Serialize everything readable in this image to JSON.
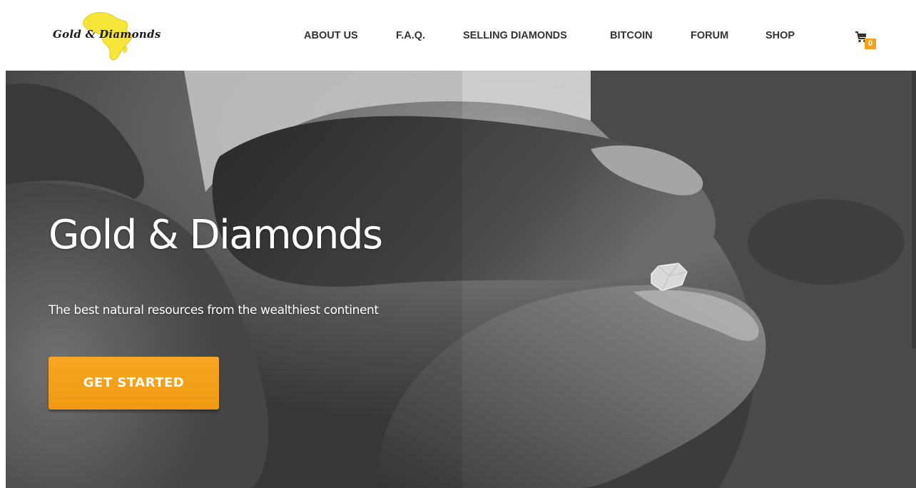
{
  "header": {
    "logo_text": "Gold & Diamonds",
    "nav": [
      {
        "label": "ABOUT US"
      },
      {
        "label": "F.A.Q."
      },
      {
        "label": "SELLING DIAMONDS"
      },
      {
        "label": "BITCOIN"
      },
      {
        "label": "FORUM"
      },
      {
        "label": "SHOP"
      }
    ],
    "cart": {
      "icon": "cart-icon",
      "count": "0"
    }
  },
  "hero": {
    "title": "Gold & Diamonds",
    "subtitle": "The best natural resources from the wealthiest continent",
    "cta_label": "GET STARTED"
  },
  "colors": {
    "accent": "#f4a21d",
    "logo_africa": "#f7e63a",
    "nav_text": "#333333"
  }
}
